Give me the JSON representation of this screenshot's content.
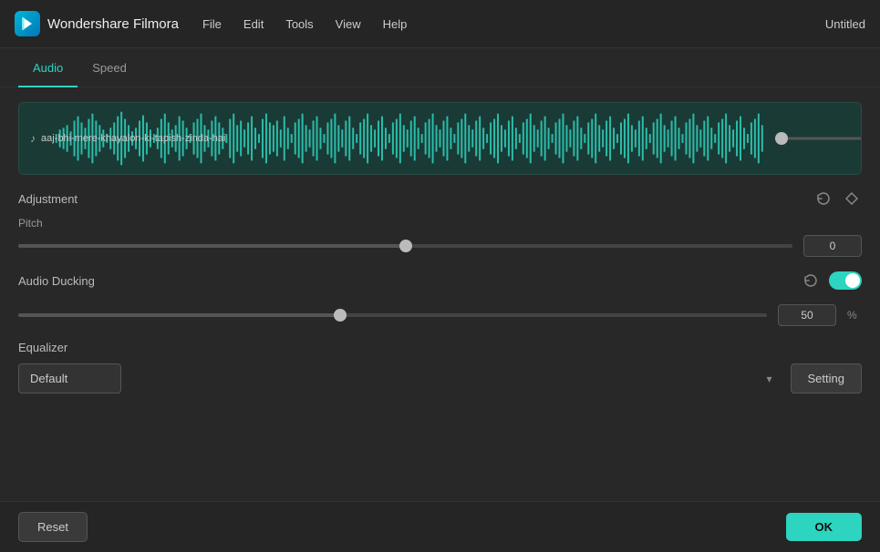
{
  "app": {
    "name": "Wondershare Filmora",
    "title": "Untitled"
  },
  "menu": {
    "items": [
      "File",
      "Edit",
      "Tools",
      "View",
      "Help"
    ]
  },
  "tabs": {
    "items": [
      {
        "label": "Audio",
        "active": true
      },
      {
        "label": "Speed",
        "active": false
      }
    ]
  },
  "waveform": {
    "filename": "aaj-bhi-mere-khayalon-ki-tapish-zinda-hai"
  },
  "adjustment": {
    "label": "Adjustment",
    "pitch_label": "Pitch",
    "pitch_value": "0"
  },
  "audio_ducking": {
    "label": "Audio Ducking",
    "value": "50",
    "unit": "%",
    "slider_percent": 43
  },
  "equalizer": {
    "label": "Equalizer",
    "select_value": "Default",
    "setting_label": "Setting"
  },
  "partial": {
    "label": ""
  },
  "footer": {
    "reset_label": "Reset",
    "ok_label": "OK"
  }
}
